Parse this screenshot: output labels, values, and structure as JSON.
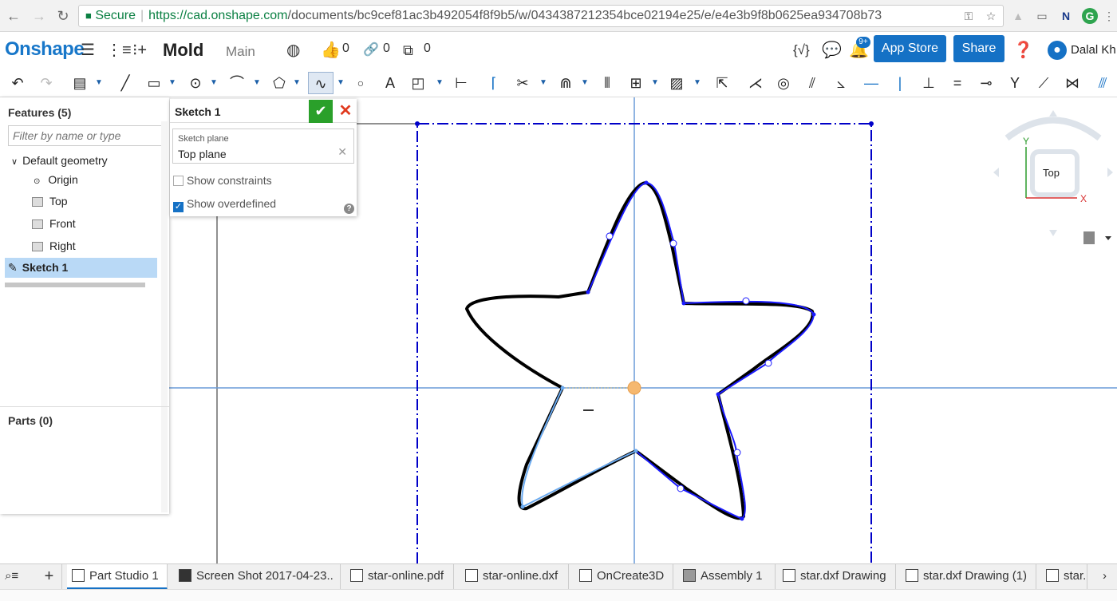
{
  "browser": {
    "secure_label": "Secure",
    "url_host": "https://cad.onshape.com",
    "url_path": "/documents/bc9cef81ac3b492054f8f9b5/w/043438721​2354bce02194e25/e/e4e3b9f8b0625ea934708b73"
  },
  "header": {
    "logo": "Onshape",
    "document_name": "Mold",
    "workspace": "Main",
    "likes": "0",
    "links": "0",
    "copies": "0",
    "notification_badge": "9+",
    "app_store_label": "App Store",
    "share_label": "Share",
    "user_name": "Dalal Kh"
  },
  "feature_panel": {
    "title": "Features (5)",
    "filter_placeholder": "Filter by name or type",
    "default_geometry": "Default geometry",
    "origin": "Origin",
    "top": "Top",
    "front": "Front",
    "right": "Right",
    "sketch": "Sketch 1",
    "parts_title": "Parts (0)"
  },
  "sketch_dialog": {
    "title": "Sketch 1",
    "plane_label": "Sketch plane",
    "plane_value": "Top plane",
    "show_constraints": "Show constraints",
    "show_overdefined": "Show overdefined"
  },
  "view_cube": {
    "face": "Top",
    "axis_y": "Y",
    "axis_x": "X"
  },
  "tabs": [
    {
      "label": "Part Studio 1"
    },
    {
      "label": "Screen Shot 2017-04-23.."
    },
    {
      "label": "star-online.pdf"
    },
    {
      "label": "star-online.dxf"
    },
    {
      "label": "OnCreate3D"
    },
    {
      "label": "Assembly 1"
    },
    {
      "label": "star.dxf Drawing"
    },
    {
      "label": "star.dxf Drawing (1)"
    },
    {
      "label": "star."
    }
  ],
  "colors": {
    "accent": "#1571c5",
    "logo": "#1877c9",
    "confirm": "#2aa02a",
    "cancel": "#e03a1e",
    "selection": "#b9d9f6",
    "sketch_curve": "#1a1aff",
    "construction": "#0000c8"
  }
}
